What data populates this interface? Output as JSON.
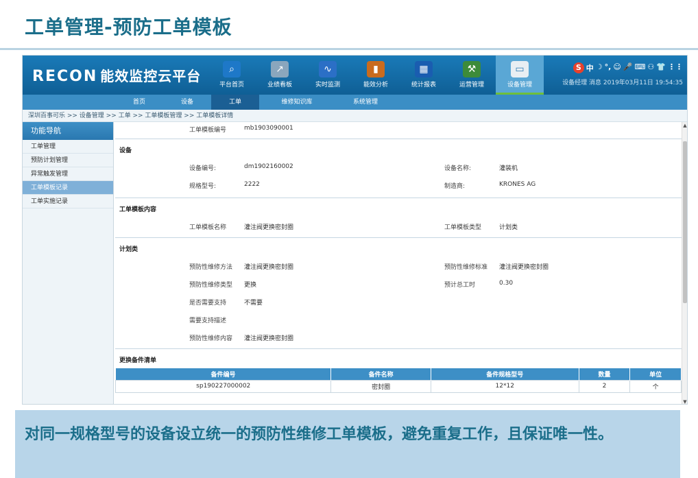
{
  "slide": {
    "title": "工单管理-预防工单模板",
    "caption": "对同一规格型号的设备设立统一的预防性维修工单模板，避免重复工作，且保证唯一性。"
  },
  "header": {
    "logo_text": "RECON",
    "logo_suffix": "能效监控云平台",
    "modules": [
      {
        "label": "平台首页",
        "icon": "magnifier-globe-icon",
        "color": "#1e78c8"
      },
      {
        "label": "业绩看板",
        "icon": "chart-board-icon",
        "color": "#8aa6bd"
      },
      {
        "label": "实时监测",
        "icon": "monitor-wave-icon",
        "color": "#2b6fc6"
      },
      {
        "label": "能效分析",
        "icon": "bar-analysis-icon",
        "color": "#c96b1e"
      },
      {
        "label": "统计报表",
        "icon": "stats-screen-icon",
        "color": "#1a5db0"
      },
      {
        "label": "运营管理",
        "icon": "worker-tools-icon",
        "color": "#3d8b3a"
      },
      {
        "label": "设备管理",
        "icon": "device-box-icon",
        "color": "#e8eef3"
      }
    ],
    "active_module": "设备管理",
    "ime_chars": [
      "S",
      "中",
      "☽",
      "°,",
      "☺",
      "🎤",
      "⌨",
      "⚇",
      "👕",
      "⋮⋮"
    ],
    "user_line": "设备经理 消息 2019年03月11日 19:54:35"
  },
  "subnav": {
    "items": [
      "首页",
      "设备",
      "工单",
      "维修知识库",
      "系统管理"
    ],
    "active": "工单"
  },
  "breadcrumb": "深圳百事可乐 >> 设备管理 >> 工单 >> 工单模板管理 >> 工单模板详情",
  "sidebar": {
    "title": "功能导航",
    "items": [
      "工单管理",
      "预防计划管理",
      "异常触发管理",
      "工单模板记录",
      "工单实施记录"
    ],
    "active": "工单模板记录"
  },
  "detail": {
    "template_no_label": "工单模板编号",
    "template_no": "mb1903090001",
    "section_device": "设备",
    "device_no_label": "设备编号:",
    "device_no": "dm1902160002",
    "device_name_label": "设备名称:",
    "device_name": "灌装机",
    "model_label": "规格型号:",
    "model": "2222",
    "maker_label": "制造商:",
    "maker": "KRONES AG",
    "section_content": "工单模板内容",
    "tpl_name_label": "工单模板名称",
    "tpl_name": "灌注阀更换密封圈",
    "tpl_type_label": "工单模板类型",
    "tpl_type": "计划类",
    "section_plan": "计划类",
    "method_label": "预防性维修方法",
    "method": "灌注阀更换密封圈",
    "standard_label": "预防性维修标准",
    "standard": "灌注阀更换密封圈",
    "kind_label": "预防性维修类型",
    "kind": "更换",
    "hours_label": "预计总工时",
    "hours": "0.30",
    "support_label": "是否需要支持",
    "support": "不需要",
    "support_desc_label": "需要支持描述",
    "support_desc": "",
    "content_label": "预防性维修内容",
    "content": "灌注阀更换密封圈",
    "section_parts": "更换备件清单"
  },
  "parts_table": {
    "headers": [
      "备件编号",
      "备件名称",
      "备件规格型号",
      "数量",
      "单位"
    ],
    "rows": [
      [
        "sp190227000002",
        "密封圈",
        "12*12",
        "2",
        "个"
      ]
    ]
  }
}
